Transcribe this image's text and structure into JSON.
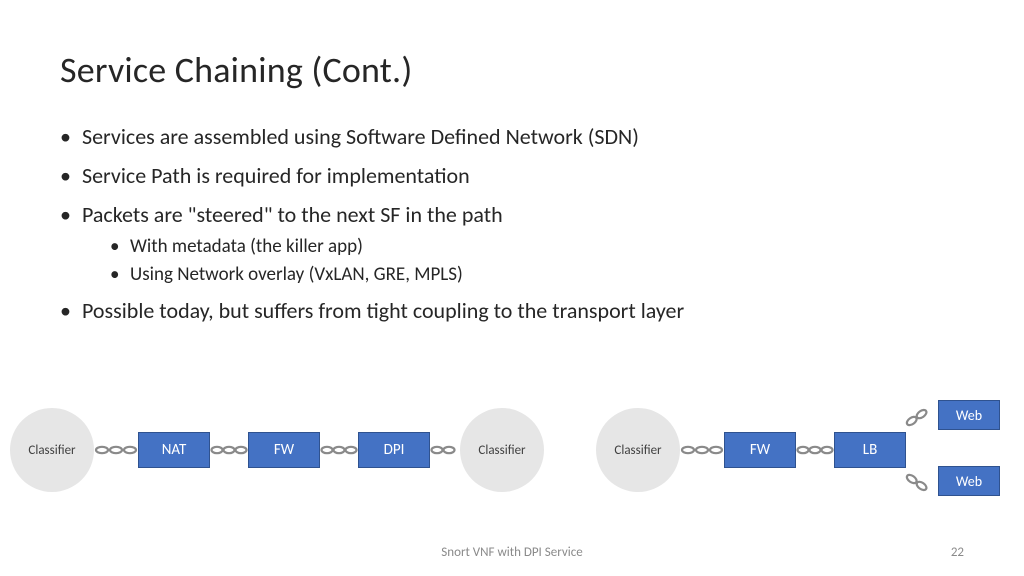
{
  "title": "Service Chaining (Cont.)",
  "bullets": {
    "b1": "Services are assembled using Software Defined Network (SDN)",
    "b2": "Service Path is required for implementation",
    "b3": "Packets are \"steered\" to the next SF in the path",
    "b3a": "With metadata (the killer app)",
    "b3b": "Using Network overlay (VxLAN, GRE, MPLS)",
    "b4": "Possible today, but suffers from tight coupling to the transport layer"
  },
  "diagram": {
    "left_chain": {
      "start": "Classifier",
      "nodes": [
        "NAT",
        "FW",
        "DPI"
      ],
      "end": "Classifier"
    },
    "right_chain": {
      "start": "Classifier",
      "nodes": [
        "FW",
        "LB"
      ],
      "ends": [
        "Web",
        "Web"
      ]
    }
  },
  "footer": "Snort VNF with DPI Service",
  "page": "22"
}
